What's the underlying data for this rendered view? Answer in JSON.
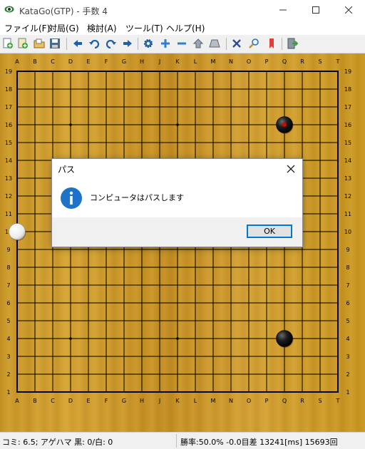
{
  "window": {
    "title": "KataGo(GTP) - 手数 4",
    "controls": [
      "minimize",
      "maximize",
      "close"
    ]
  },
  "menu": {
    "items": [
      "ファイル(F)",
      "対局(G)",
      "検討(A)",
      "ツール(T)",
      "ヘルプ(H)"
    ]
  },
  "toolbar": {
    "buttons": [
      {
        "name": "new-game-icon"
      },
      {
        "name": "new-board-icon"
      },
      {
        "name": "open-file-icon"
      },
      {
        "name": "save-file-icon"
      },
      {
        "name": "move-back-icon"
      },
      {
        "name": "undo-icon"
      },
      {
        "name": "redo-icon"
      },
      {
        "name": "move-forward-icon"
      },
      {
        "name": "settings-icon"
      },
      {
        "name": "zoom-in-icon"
      },
      {
        "name": "zoom-out-icon"
      },
      {
        "name": "home-icon"
      },
      {
        "name": "eraser-icon"
      },
      {
        "name": "cross-icon"
      },
      {
        "name": "search-icon"
      },
      {
        "name": "bookmark-icon"
      },
      {
        "name": "exit-icon"
      }
    ]
  },
  "board": {
    "size": 19,
    "column_labels": [
      "A",
      "B",
      "C",
      "D",
      "E",
      "F",
      "G",
      "H",
      "J",
      "K",
      "L",
      "M",
      "N",
      "O",
      "P",
      "Q",
      "R",
      "S",
      "T"
    ],
    "row_labels": [
      "19",
      "18",
      "17",
      "16",
      "15",
      "14",
      "13",
      "12",
      "11",
      "10",
      "9",
      "8",
      "7",
      "6",
      "5",
      "4",
      "3",
      "2",
      "1"
    ],
    "star_points": [
      "D16",
      "K16",
      "Q16",
      "D10",
      "K10",
      "Q10",
      "D4",
      "K4",
      "Q4"
    ],
    "stones": [
      {
        "color": "black",
        "coord": "Q16",
        "last_move": true
      },
      {
        "color": "white",
        "coord": "A10",
        "last_move": false
      },
      {
        "color": "black",
        "coord": "Q4",
        "last_move": false
      }
    ],
    "colors": {
      "board": "#c99727",
      "line": "#000000",
      "last_move_marker": "#e00000"
    }
  },
  "dialog": {
    "title": "パス",
    "message": "コンピュータはパスします",
    "ok_label": "OK",
    "icon": "info-icon"
  },
  "status": {
    "left": "コミ: 6.5; アゲハマ 黒: 0/白: 0",
    "right": "勝率:50.0% -0.0目差 13241[ms] 15693回"
  }
}
